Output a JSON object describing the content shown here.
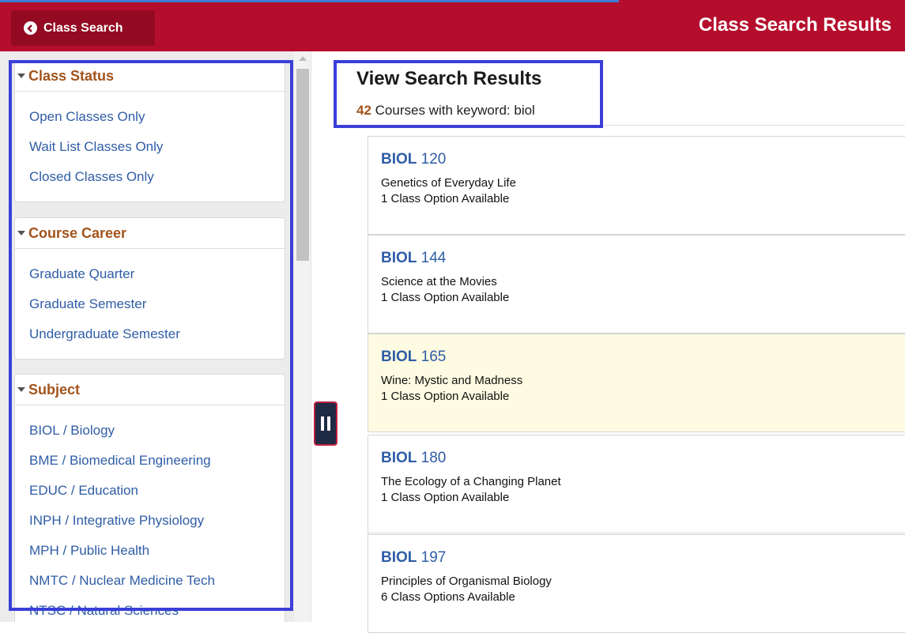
{
  "header": {
    "back_label": "Class Search",
    "page_title": "Class Search Results"
  },
  "sidebar": {
    "class_status": {
      "heading": "Class Status",
      "items": [
        "Open Classes Only",
        "Wait List Classes Only",
        "Closed Classes Only"
      ]
    },
    "course_career": {
      "heading": "Course Career",
      "items": [
        "Graduate Quarter",
        "Graduate Semester",
        "Undergraduate Semester"
      ]
    },
    "subject": {
      "heading": "Subject",
      "items": [
        "BIOL / Biology",
        "BME / Biomedical Engineering",
        "EDUC / Education",
        "INPH / Integrative Physiology",
        "MPH / Public Health",
        "NMTC / Nuclear Medicine Tech",
        "NTSC / Natural Sciences"
      ]
    }
  },
  "results": {
    "title": "View Search Results",
    "count": "42",
    "summary_text": " Courses with keyword: biol",
    "courses": [
      {
        "subject": "BIOL",
        "number": "120",
        "title": "Genetics of Everyday Life",
        "options": "1 Class Option Available"
      },
      {
        "subject": "BIOL",
        "number": "144",
        "title": "Science at the Movies",
        "options": "1 Class Option Available"
      },
      {
        "subject": "BIOL",
        "number": "165",
        "title": "Wine: Mystic and Madness",
        "options": "1 Class Option Available"
      },
      {
        "subject": "BIOL",
        "number": "180",
        "title": "The Ecology of a Changing Planet",
        "options": "1 Class Option Available"
      },
      {
        "subject": "BIOL",
        "number": "197",
        "title": "Principles of Organismal Biology",
        "options": "6 Class Options Available"
      }
    ]
  },
  "colors": {
    "brand_red": "#b50e2c",
    "link_blue": "#2f5da6",
    "heading_brown": "#a2531b",
    "highlight_frame": "#3a3fd8",
    "selected_card_bg": "#fdfbe1"
  }
}
